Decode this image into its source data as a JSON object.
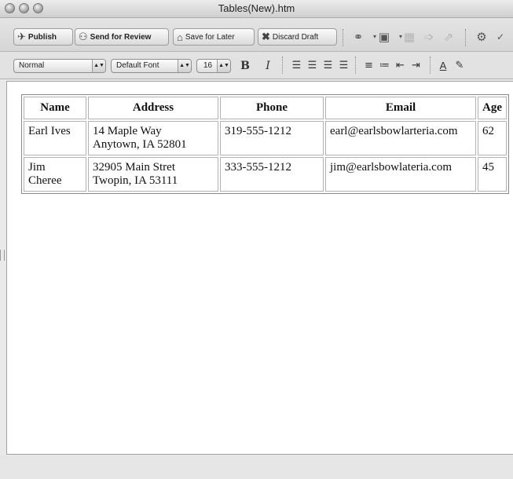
{
  "window": {
    "title": "Tables(New).htm"
  },
  "toolbar": {
    "publish_label": "Publish",
    "send_review_label": "Send for Review",
    "save_later_label": "Save for Later",
    "discard_label": "Discard Draft"
  },
  "format": {
    "style_value": "Normal",
    "font_value": "Default Font",
    "size_value": "16",
    "bold_label": "B",
    "italic_label": "I",
    "font_color_label": "A"
  },
  "table": {
    "headers": [
      "Name",
      "Address",
      "Phone",
      "Email",
      "Age"
    ],
    "rows": [
      {
        "name": "Earl Ives",
        "address_line1": "14 Maple Way",
        "address_line2": "Anytown, IA 52801",
        "phone": "319-555-1212",
        "email": "earl@earlsbowlarteria.com",
        "age": "62"
      },
      {
        "name_line1": "Jim",
        "name_line2": "Cheree",
        "address_line1": "32905 Main Stret",
        "address_line2": "Twopin, IA 53111",
        "phone": "333-555-1212",
        "email": "jim@earlsbowlateria.com",
        "age": "45"
      }
    ]
  },
  "icons": [
    "publish-icon",
    "send-review-icon",
    "save-later-icon",
    "discard-icon",
    "link-icon",
    "image-icon",
    "table-icon",
    "arrow-right-icon",
    "share-icon",
    "gear-icon",
    "spell-check-icon"
  ]
}
